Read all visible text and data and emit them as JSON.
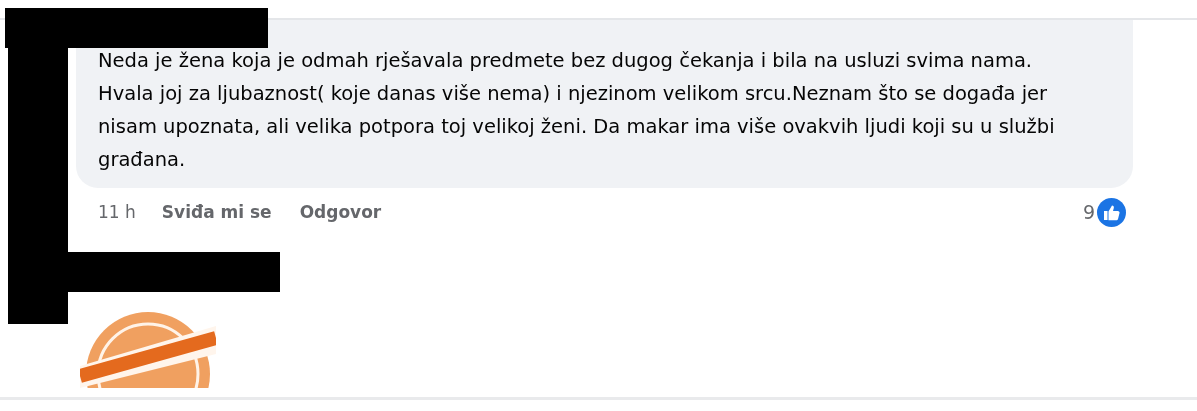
{
  "comment": {
    "text": "Neda je žena koja je odmah rješavala predmete bez dugog čekanja i bila na usluzi svima nama. Hvala joj za ljubaznost( koje danas više nema) i njezinom velikom srcu.Neznam što se događa jer nisam upoznata, ali velika potpora toj velikoj ženi. Da makar ima više ovakvih ljudi koji su u službi građana.",
    "time": "11 h",
    "actions": [
      "Sviđa mi se",
      "Odgovor"
    ],
    "reaction_count": "9"
  }
}
